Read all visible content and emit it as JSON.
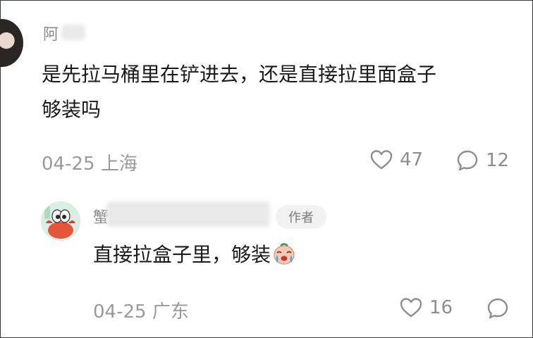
{
  "comments": [
    {
      "username": "阿",
      "text_line1": "是先拉马桶里在铲进去，还是直接拉里面盒子",
      "text_line2": "够装吗",
      "date": "04-25",
      "location": "上海",
      "likes": "47",
      "replies": "12"
    }
  ],
  "reply": {
    "username": "蟹",
    "author_badge": "作者",
    "text": "直接拉盒子里，够装",
    "date": "04-25",
    "location": "广东",
    "likes": "16"
  },
  "icons": {
    "like": "heart-outline-icon",
    "reply": "speech-bubble-icon",
    "emoji": "crying-face-emoji"
  }
}
